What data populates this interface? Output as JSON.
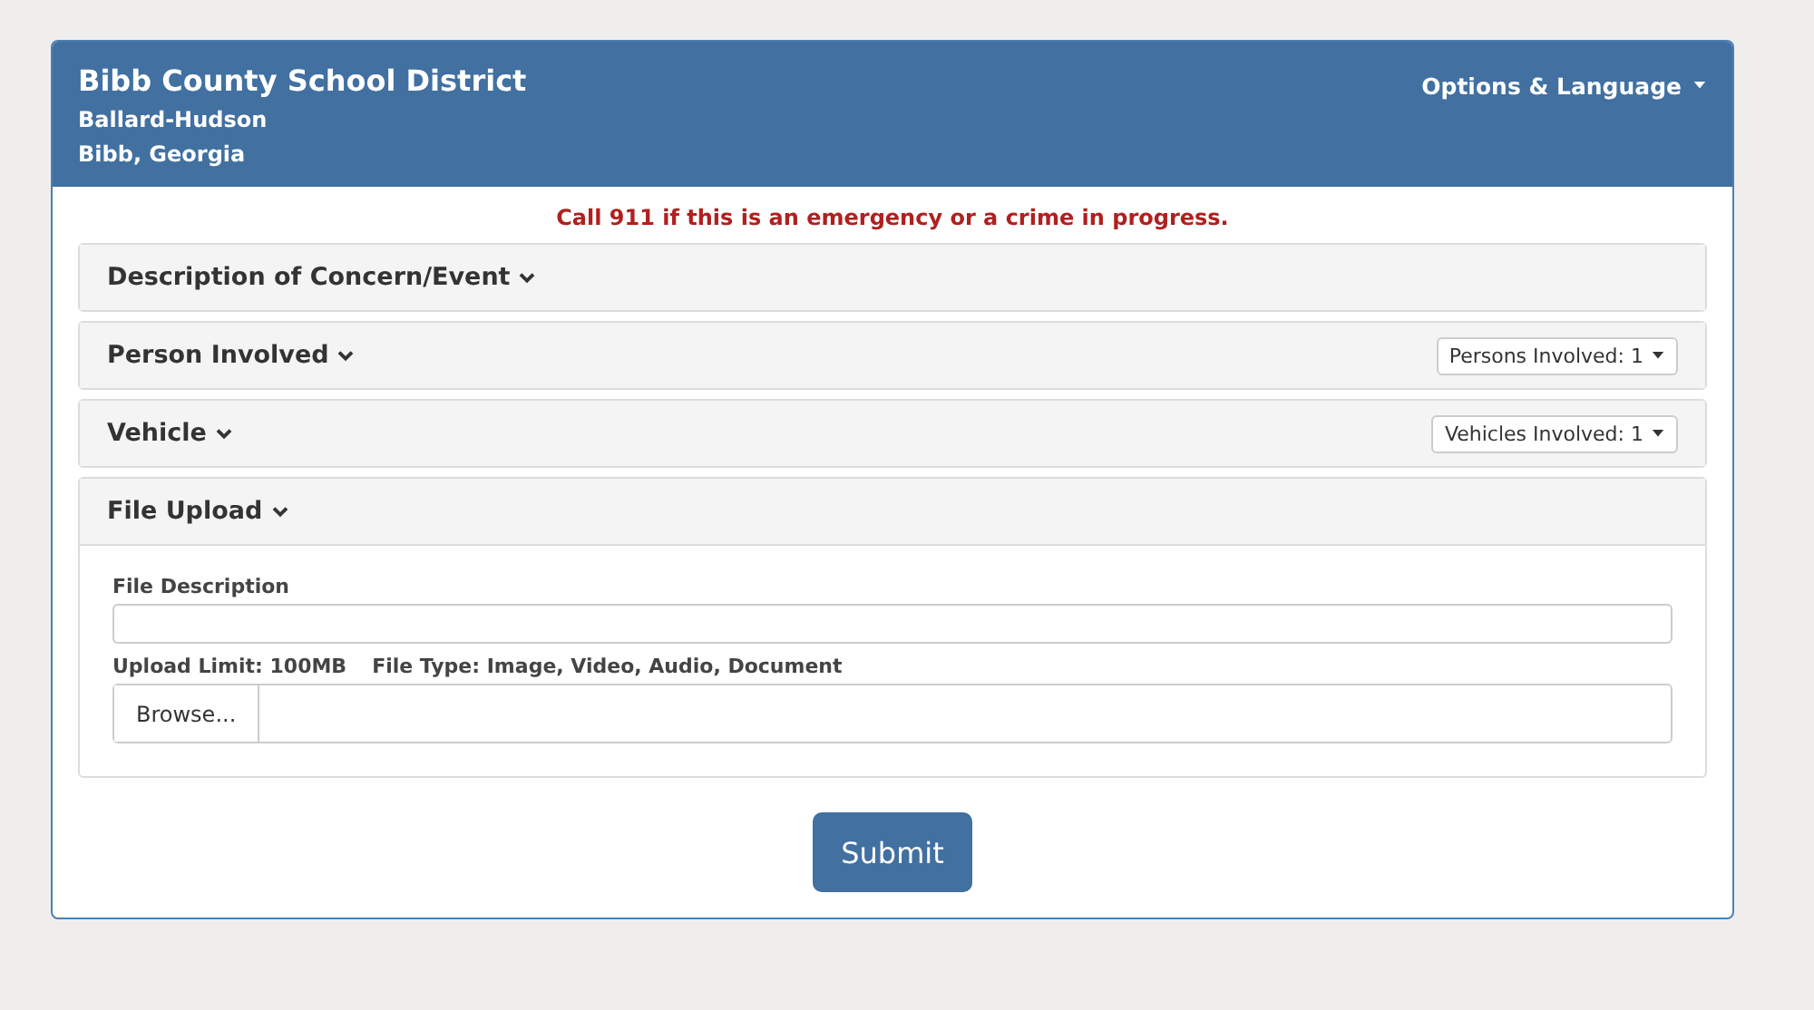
{
  "header": {
    "title": "Bibb County School District",
    "school": "Ballard-Hudson",
    "location": "Bibb, Georgia",
    "menu": "Options & Language"
  },
  "alert": "Call 911 if this is an emergency or a crime in progress.",
  "sections": [
    {
      "title": "Description of Concern/Event"
    },
    {
      "title": "Person Involved",
      "dropdown": "Persons Involved: 1"
    },
    {
      "title": "Vehicle",
      "dropdown": "Vehicles Involved: 1"
    },
    {
      "title": "File Upload",
      "body": {
        "description_label": "File Description",
        "limit": "Upload Limit: 100MB",
        "types": "File Type: Image, Video, Audio, Document",
        "browse": "Browse..."
      }
    }
  ],
  "submit": "Submit"
}
